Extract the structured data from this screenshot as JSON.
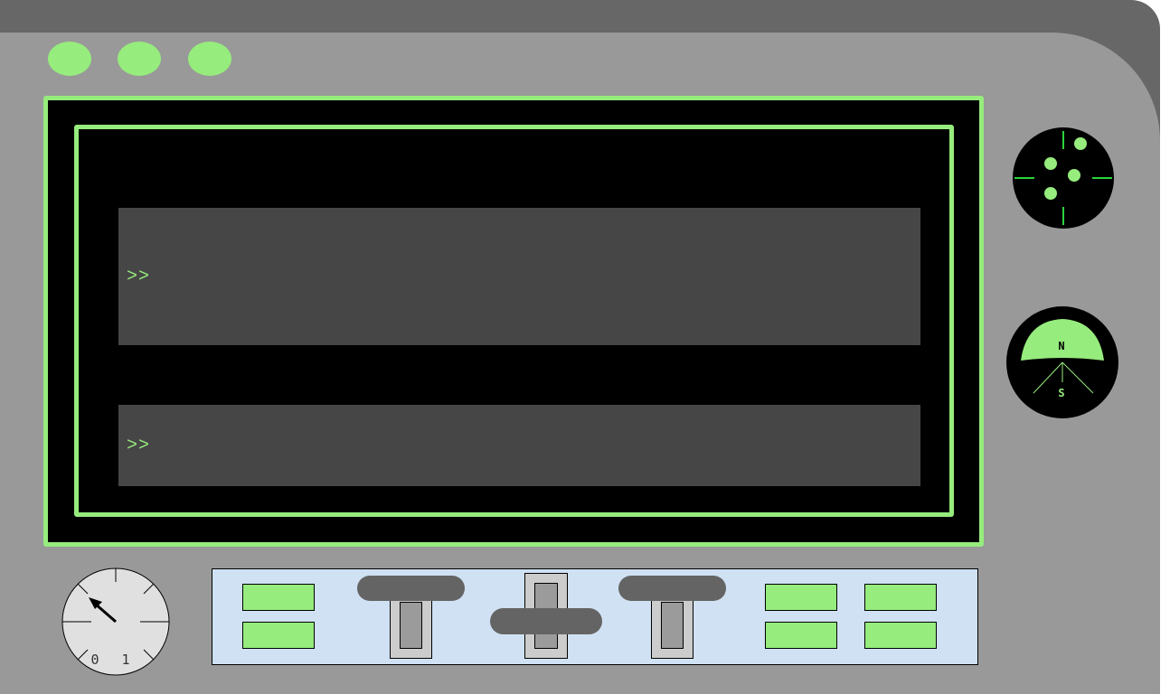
{
  "console": {
    "top_prompt": ">>",
    "bottom_prompt": ">>"
  },
  "compass": {
    "north_label": "N",
    "south_label": "S"
  },
  "gauge": {
    "label_zero": "0",
    "label_one": "1"
  },
  "colors": {
    "accent": "#96ec7d",
    "frame_dark": "#676767",
    "panel": "#999999",
    "screen": "#000000",
    "console_bg": "#464646",
    "control_bg": "#cfe1f3",
    "handle": "#646464"
  },
  "icons": [
    "indicator-light",
    "radar-icon",
    "compass-icon",
    "analog-gauge"
  ]
}
